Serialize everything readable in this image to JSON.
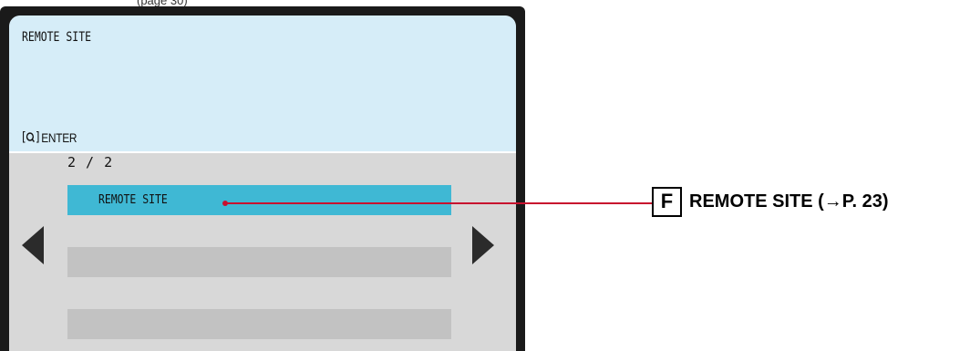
{
  "page_caption": "(page 30)",
  "screen": {
    "title": "REMOTE SITE",
    "hint": {
      "open_bracket": "[",
      "close_bracket": "]",
      "icon": "zoom-key-icon",
      "label": "ENTER"
    },
    "page_counter": "2 / 2",
    "items": [
      {
        "label": "REMOTE SITE",
        "selected": true
      },
      {
        "label": "",
        "selected": false
      },
      {
        "label": "",
        "selected": false
      }
    ],
    "nav": {
      "left_icon": "arrow-left-icon",
      "right_icon": "arrow-right-icon"
    }
  },
  "callout": {
    "badge": "F",
    "text": "REMOTE SITE (→P. 23)"
  },
  "colors": {
    "bezel": "#1a1a1a",
    "info_panel": "#d6edf8",
    "list_panel": "#d8d8d8",
    "selected_item": "#3fb8d4",
    "empty_item": "#c2c2c2",
    "callout_line": "#c8102e"
  }
}
